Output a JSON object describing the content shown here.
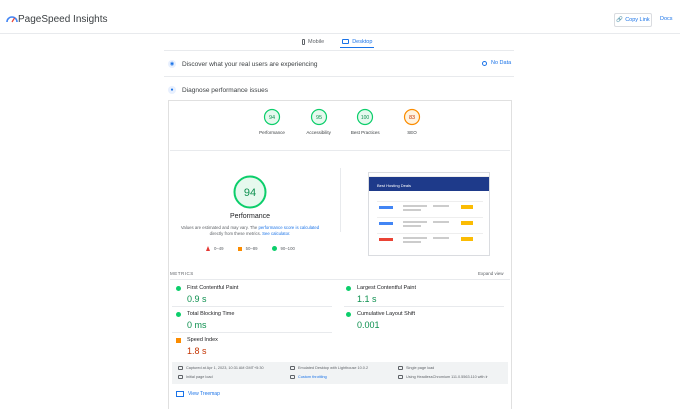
{
  "header": {
    "brand": "PageSpeed Insights",
    "copy_link": "Copy Link",
    "docs": "Docs"
  },
  "tabs": [
    {
      "label": "Mobile",
      "active": false
    },
    {
      "label": "Desktop",
      "active": true
    }
  ],
  "crux": {
    "title": "Discover what your real users are experiencing",
    "no_data": "No Data"
  },
  "diagnose": {
    "title": "Diagnose performance issues"
  },
  "scores": [
    {
      "label": "Performance",
      "value": "94",
      "color": "#0cce6b"
    },
    {
      "label": "Accessibility",
      "value": "95",
      "color": "#0cce6b"
    },
    {
      "label": "Best Practices",
      "value": "100",
      "color": "#0cce6b"
    },
    {
      "label": "SEO",
      "value": "83",
      "color": "#fb8c00"
    }
  ],
  "performance": {
    "score": "94",
    "title": "Performance",
    "note_1": "Values are estimated and may vary. The ",
    "note_link": "performance score is calculated",
    "note_2": " directly from these metrics. ",
    "note_link2": "See calculator.",
    "legend": [
      "0–49",
      "50–89",
      "90–100"
    ]
  },
  "screenshot": {
    "hero_title": "Best Hosting Deals"
  },
  "metrics": {
    "label": "METRICS",
    "expand": "Expand view",
    "items": [
      {
        "name": "First Contentful Paint",
        "value": "0.9 s",
        "status": "good"
      },
      {
        "name": "Largest Contentful Paint",
        "value": "1.1 s",
        "status": "good"
      },
      {
        "name": "Total Blocking Time",
        "value": "0 ms",
        "status": "good"
      },
      {
        "name": "Cumulative Layout Shift",
        "value": "0.001",
        "status": "good"
      },
      {
        "name": "Speed Index",
        "value": "1.8 s",
        "status": "average"
      }
    ]
  },
  "footer": {
    "captured": "Captured at Apr 1, 2023, 10:31 AM GMT+5:30",
    "emulated": "Emulated Desktop with Lighthouse 10.0.2",
    "single_load": "Single page load",
    "initial_load": "Initial page load",
    "throttling": "Custom throttling",
    "chromium": "Using HeadlessChromium 111.0.5563.110 with lr",
    "treemap": "View Treemap"
  }
}
